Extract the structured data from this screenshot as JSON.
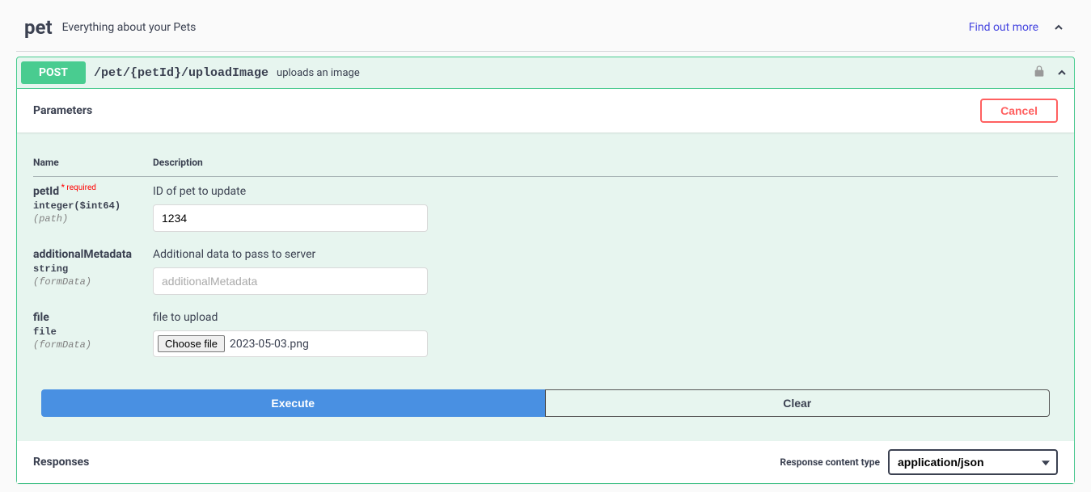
{
  "tag": {
    "title": "pet",
    "description": "Everything about your Pets",
    "link_text": "Find out more"
  },
  "operation": {
    "method": "POST",
    "path": "/pet/{petId}/uploadImage",
    "summary": "uploads an image"
  },
  "parameters_section": {
    "title": "Parameters",
    "cancel_label": "Cancel",
    "columns": {
      "name": "Name",
      "description": "Description"
    },
    "rows": [
      {
        "name": "petId",
        "required_text": " required",
        "type": "integer($int64)",
        "in": "(path)",
        "description": "ID of pet to update",
        "value": "1234",
        "placeholder": ""
      },
      {
        "name": "additionalMetadata",
        "type": "string",
        "in": "(formData)",
        "description": "Additional data to pass to server",
        "value": "",
        "placeholder": "additionalMetadata"
      },
      {
        "name": "file",
        "type": "file",
        "in": "(formData)",
        "description": "file to upload",
        "choose_label": "Choose file",
        "file_name": "2023-05-03.png"
      }
    ]
  },
  "actions": {
    "execute": "Execute",
    "clear": "Clear"
  },
  "responses_section": {
    "title": "Responses",
    "content_type_label": "Response content type",
    "content_type_value": "application/json"
  }
}
